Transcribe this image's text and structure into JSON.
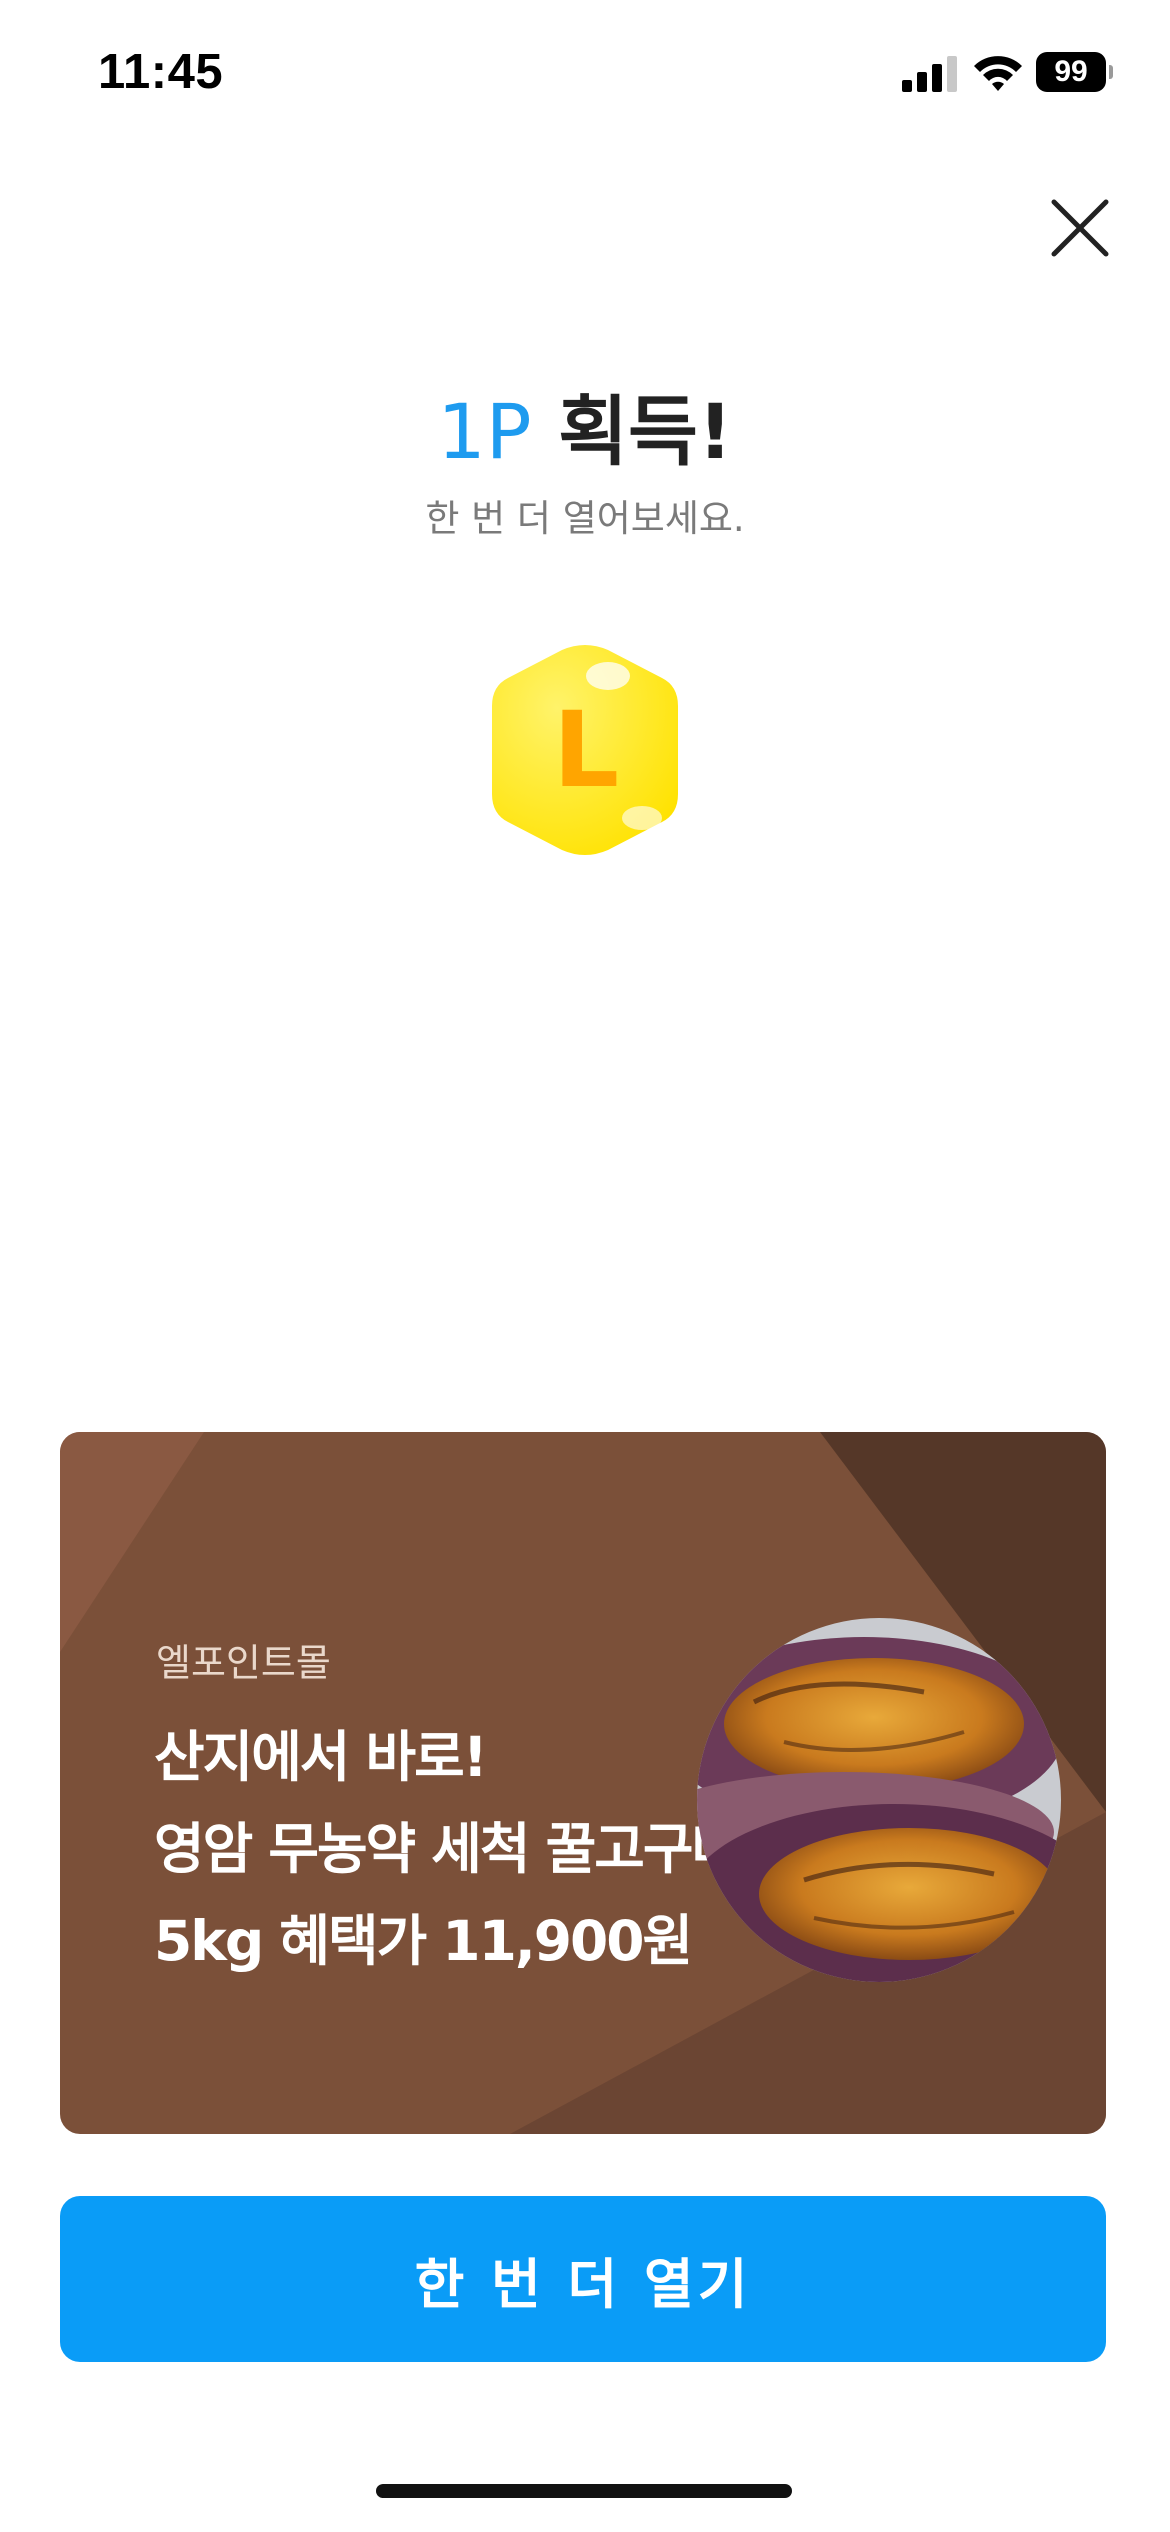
{
  "status_bar": {
    "time": "11:45",
    "battery_level": "99",
    "icons": [
      "signal-icon",
      "wifi-icon",
      "battery-icon"
    ]
  },
  "close": {
    "icon": "close-icon"
  },
  "reward": {
    "amount": "1P",
    "title_suffix": " 획득!",
    "subtitle": "한 번 더 열어보세요.",
    "badge_letter": "L",
    "badge_color": "#ffe400",
    "accent_color": "#1e9bef"
  },
  "ad": {
    "brand": "엘포인트몰",
    "line1": "산지에서 바로!",
    "line2": "영암 무농약 세척 꿀고구마",
    "line3": "5kg 혜택가 11,900원",
    "background_color": "#7b5039"
  },
  "cta": {
    "label": "한 번 더 열기",
    "color": "#0a9cf7"
  }
}
